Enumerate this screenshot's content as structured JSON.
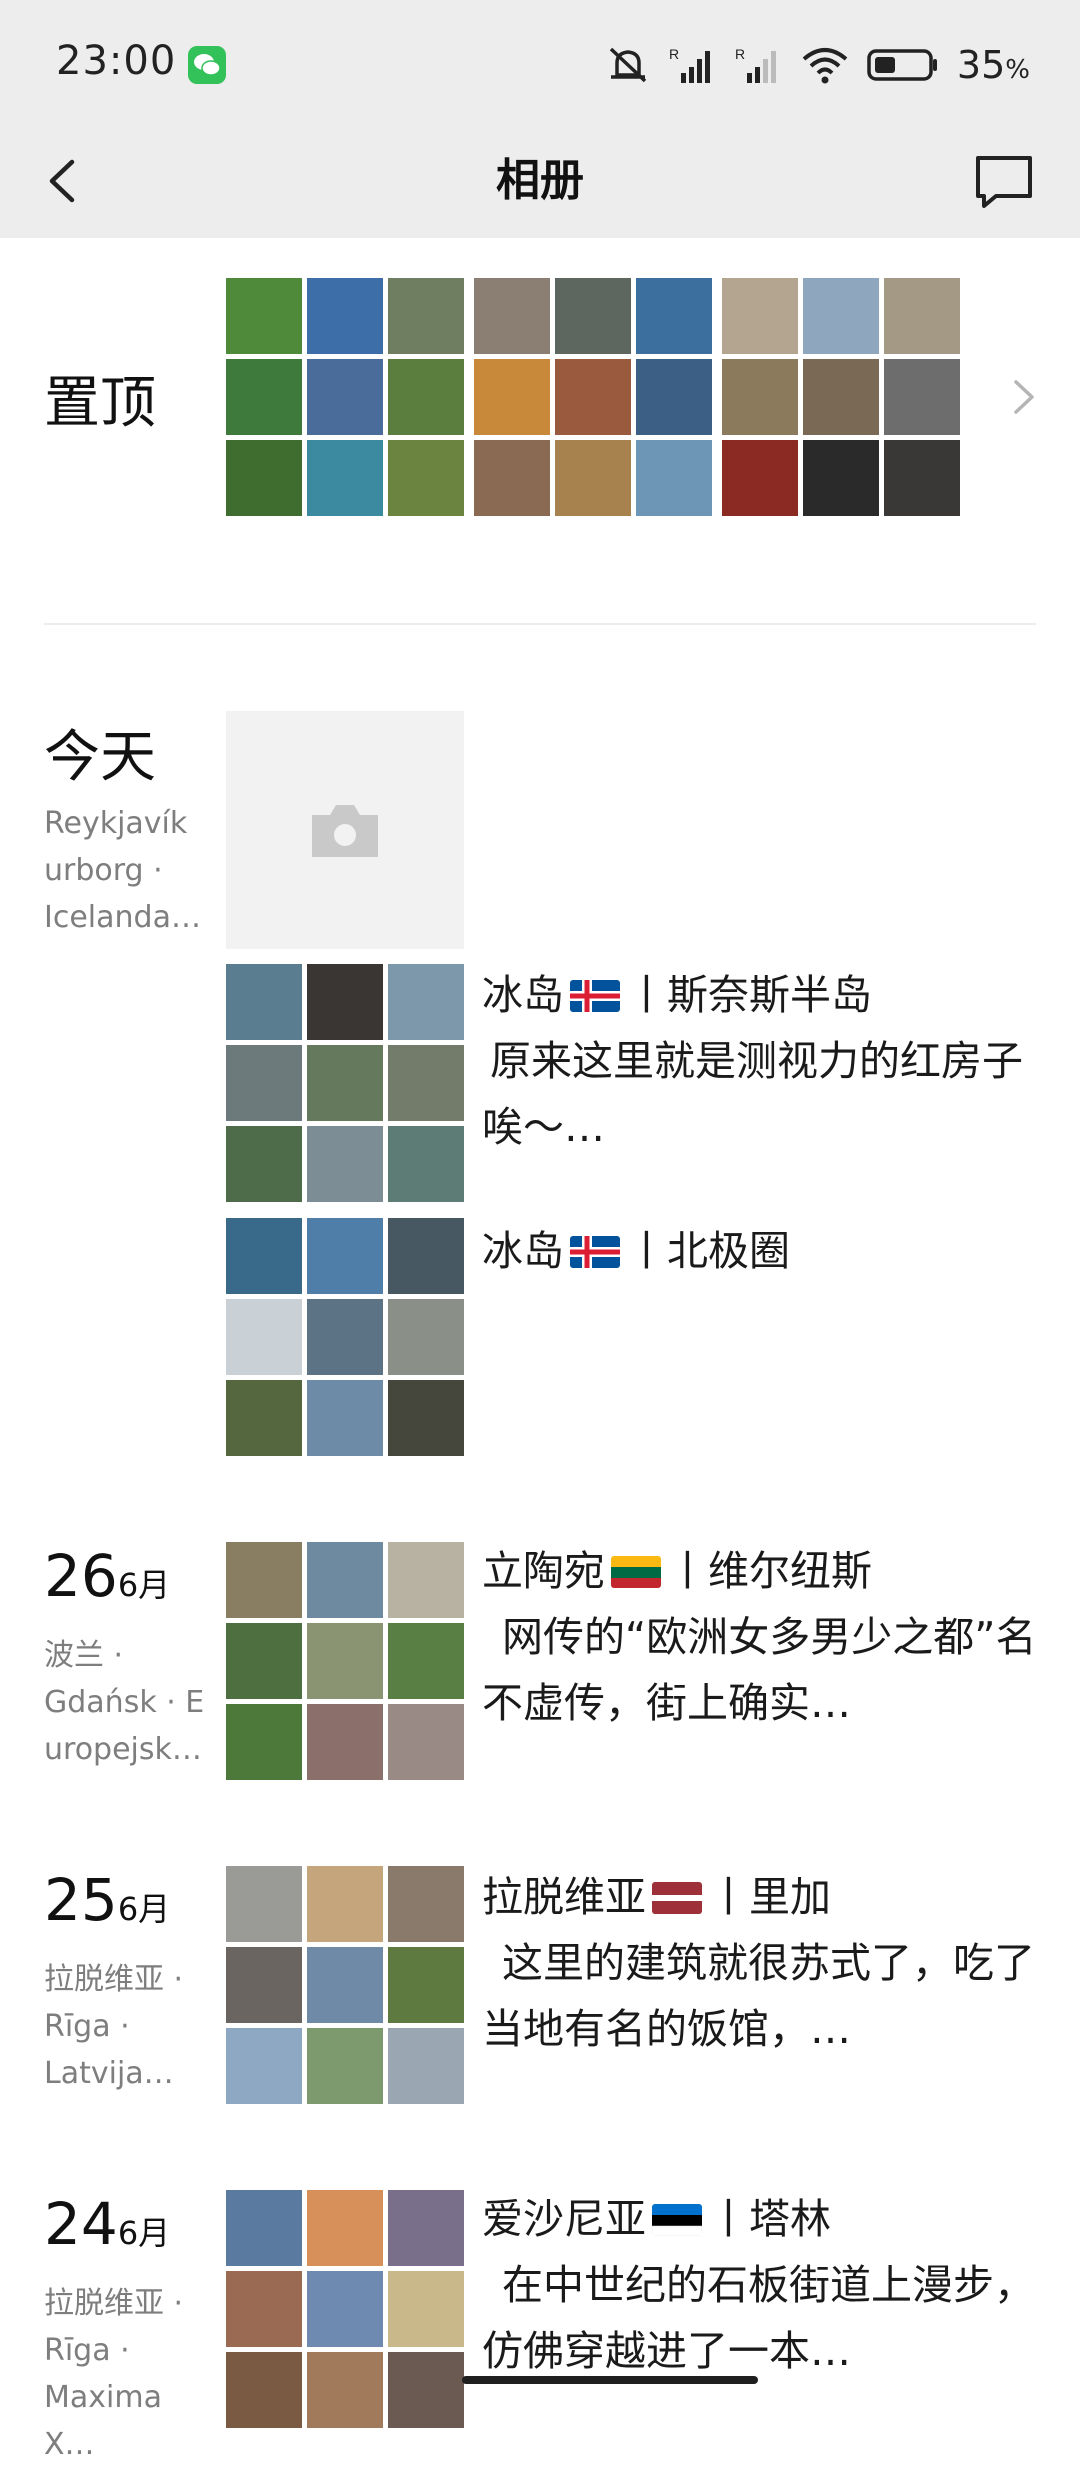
{
  "status_bar": {
    "time": "23:00",
    "battery": "35",
    "battery_unit": "%"
  },
  "header": {
    "title": "相册"
  },
  "pinned": {
    "label": "置顶"
  },
  "days": [
    {
      "big": "今天",
      "location": "Reykjavík urborg · Icelanda…"
    },
    {
      "num": "26",
      "month": "6月",
      "location": "波兰 · Gdańsk · E uropejsk…"
    },
    {
      "num": "25",
      "month": "6月",
      "location": "拉脱维亚 · Rīga · Latvija…"
    },
    {
      "num": "24",
      "month": "6月",
      "location": "拉脱维亚 · Rīga · Maxima X…"
    }
  ],
  "entries": [
    {
      "pre": "冰岛",
      "post": "丨斯奈斯半岛",
      "body": "原来这里就是测视力的红房子唉～…",
      "flag": "iceland"
    },
    {
      "pre": "冰岛",
      "post": "丨北极圈",
      "body": "",
      "flag": "iceland"
    },
    {
      "pre": "立陶宛",
      "post": "丨维尔纽斯",
      "body": "网传的“欧洲女多男少之都”名不虚传，街上确实…",
      "flag": "lithuania"
    },
    {
      "pre": "拉脱维亚",
      "post": "丨里加",
      "body": "这里的建筑就很苏式了，吃了当地有名的饭馆，…",
      "flag": "latvia"
    },
    {
      "pre": "爱沙尼亚",
      "post": "丨塔林",
      "body": "在中世纪的石板街道上漫步，仿佛穿越进了一本…",
      "flag": "estonia"
    }
  ],
  "icons": [
    "back-arrow-icon",
    "message-icon",
    "chevron-right-icon",
    "camera-icon",
    "wechat-icon",
    "mute-icon",
    "signal-icon",
    "wifi-icon",
    "battery-icon"
  ],
  "colors": {
    "topbar": "#ededed",
    "text": "#111111",
    "location": "#7e7e7e",
    "placeholder": "#f2f2f2"
  }
}
